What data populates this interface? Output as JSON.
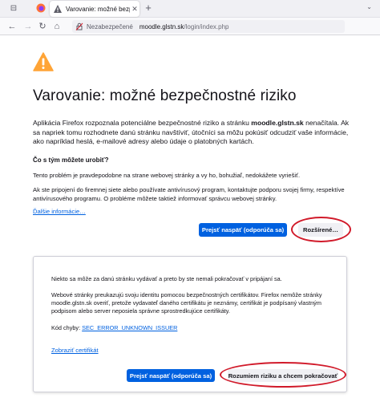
{
  "browser": {
    "tab": {
      "title": "Varovanie: možné bezpečnostné riziko",
      "close_glyph": "✕"
    },
    "new_tab_glyph": "+",
    "window_controls_glyph": "⌄",
    "nav": {
      "back_glyph": "←",
      "forward_glyph": "→",
      "reload_glyph": "↻",
      "home_glyph": "⌂"
    },
    "url": {
      "security_label": "Nezabezpečené",
      "host": "moodle.glstn.sk",
      "path": "/login/index.php"
    }
  },
  "page": {
    "title": "Varovanie: možné bezpečnostné riziko",
    "intro_part1": "Aplikácia Firefox rozpoznala potenciálne bezpečnostné riziko a stránku ",
    "intro_host": "moodle.glstn.sk",
    "intro_part2": " nenačítala. Ak sa napriek tomu rozhodnete danú stránku navštíviť, útočníci sa môžu pokúsiť odcudziť vaše informácie, ako napríklad heslá, e-mailové adresy alebo údaje o platobných kartách.",
    "what_can_you_do": "Čo s tým môžete urobiť?",
    "para1": "Tento problém je pravdepodobne na strane webovej stránky a vy ho, bohužiaľ, nedokážete vyriešiť.",
    "para2": "Ak ste pripojení do firemnej siete alebo používate antivírusový program, kontaktujte podporu svojej firmy, respektíve antivírusového programu. O probléme môžete taktiež informovať správcu webovej stránky.",
    "learn_more": "Ďalšie informácie…",
    "go_back_button": "Prejsť naspäť (odporúča sa)",
    "advanced_button": "Rozšírené…"
  },
  "advanced": {
    "text1": "Niekto sa môže za danú stránku vydávať a preto by ste nemali pokračovať v pripájaní sa.",
    "text2": "Webové stránky preukazujú svoju identitu pomocou bezpečnostných certifikátov. Firefox nemôže stránky moodle.glstn.sk overiť, pretože vydavateľ daného certifikátu je neznámy, certifikát je podpísaný vlastným podpisom alebo server neposiela správne sprostredkujúce certifikáty.",
    "error_code_label": "Kód chyby: ",
    "error_code": "SEC_ERROR_UNKNOWN_ISSUER",
    "view_certificate": "Zobraziť certifikát",
    "go_back_button": "Prejsť naspäť (odporúča sa)",
    "accept_button": "Rozumiem riziku a chcem pokračovať"
  },
  "colors": {
    "accent": "#0061e0",
    "warning": "#ffa436",
    "highlight_oval": "#d11a2a"
  }
}
